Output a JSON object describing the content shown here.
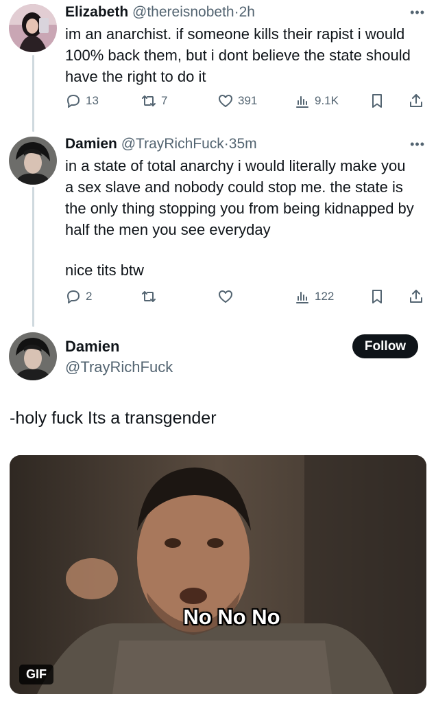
{
  "tweet1": {
    "name": "Elizabeth",
    "handle": "@thereisnobeth",
    "dot": "·",
    "time": "2h",
    "text": "im an anarchist. if someone kills their rapist i would 100% back them, but i dont believe the state should have the right to do it",
    "replies": "13",
    "reposts": "7",
    "likes": "391",
    "views": "9.1K"
  },
  "tweet2": {
    "name": "Damien",
    "handle": "@TrayRichFuck",
    "dot": "·",
    "time": "35m",
    "text": "in a state of total anarchy i would literally make you a sex slave and nobody could stop me. the state is the only thing stopping you from being kidnapped by half the men you see everyday",
    "text2": "nice tits btw",
    "replies": "2",
    "reposts": "",
    "likes": "",
    "views": "122"
  },
  "main_tweet": {
    "name": "Damien",
    "handle": "@TrayRichFuck",
    "follow_label": "Follow",
    "text": "-holy fuck Its a transgender",
    "media": {
      "caption": "No No No",
      "badge": "GIF"
    }
  },
  "icons": {
    "more": "more-horizontal-icon",
    "reply": "reply-icon",
    "repost": "repost-icon",
    "like": "heart-icon",
    "views": "views-icon",
    "bookmark": "bookmark-icon",
    "share": "share-icon"
  },
  "colors": {
    "text": "#0f1419",
    "secondary": "#536471",
    "thread_line": "#cfd9de",
    "follow_bg": "#0f1419"
  }
}
